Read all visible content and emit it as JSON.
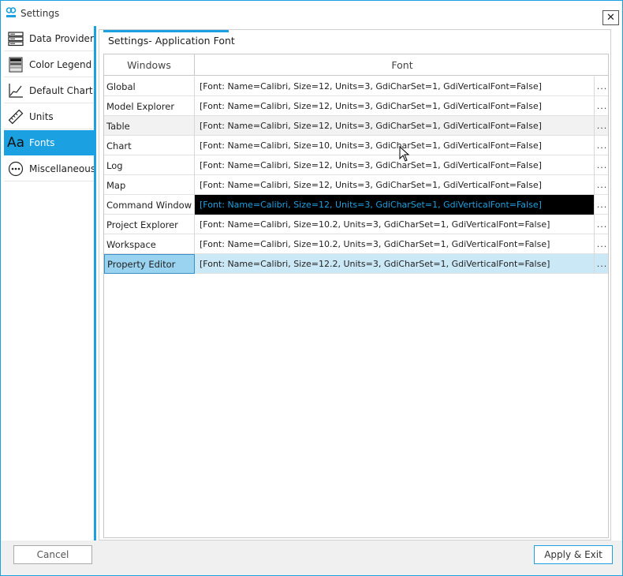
{
  "window": {
    "title": "Settings",
    "close_label": "✕",
    "accent": "#1ba1e2"
  },
  "sidebar": {
    "items": [
      {
        "label": "Data Provider",
        "icon": "server-icon"
      },
      {
        "label": "Color Legend",
        "icon": "legend-icon"
      },
      {
        "label": "Default Chart",
        "icon": "chart-icon"
      },
      {
        "label": "Units",
        "icon": "ruler-icon"
      },
      {
        "label": "Fonts",
        "icon": "font-icon",
        "glyph": "Aa"
      },
      {
        "label": "Miscellaneous",
        "icon": "more-icon"
      }
    ],
    "active_index": 4
  },
  "panel": {
    "title": "Settings- Application Font"
  },
  "grid": {
    "columns": [
      "Windows",
      "Font"
    ],
    "button_label": "...",
    "rows": [
      {
        "name": "Global",
        "font": "[Font: Name=Calibri, Size=12, Units=3, GdiCharSet=1, GdiVerticalFont=False]"
      },
      {
        "name": "Model Explorer",
        "font": "[Font: Name=Calibri, Size=12, Units=3, GdiCharSet=1, GdiVerticalFont=False]"
      },
      {
        "name": "Table",
        "font": "[Font: Name=Calibri, Size=12, Units=3, GdiCharSet=1, GdiVerticalFont=False]"
      },
      {
        "name": "Chart",
        "font": "[Font: Name=Calibri, Size=10, Units=3, GdiCharSet=1, GdiVerticalFont=False]"
      },
      {
        "name": "Log",
        "font": "[Font: Name=Calibri, Size=12, Units=3, GdiCharSet=1, GdiVerticalFont=False]"
      },
      {
        "name": "Map",
        "font": "[Font: Name=Calibri, Size=12, Units=3, GdiCharSet=1, GdiVerticalFont=False]"
      },
      {
        "name": "Command Window",
        "font": "[Font: Name=Calibri, Size=12, Units=3, GdiCharSet=1, GdiVerticalFont=False]"
      },
      {
        "name": "Project Explorer",
        "font": "[Font: Name=Calibri, Size=10.2, Units=3, GdiCharSet=1, GdiVerticalFont=False]"
      },
      {
        "name": "Workspace",
        "font": "[Font: Name=Calibri, Size=10.2, Units=3, GdiCharSet=1, GdiVerticalFont=False]"
      },
      {
        "name": "Property Editor",
        "font": "[Font: Name=Calibri, Size=12.2, Units=3, GdiCharSet=1, GdiVerticalFont=False]"
      }
    ]
  },
  "footer": {
    "cancel_label": "Cancel",
    "apply_label": "Apply & Exit"
  }
}
